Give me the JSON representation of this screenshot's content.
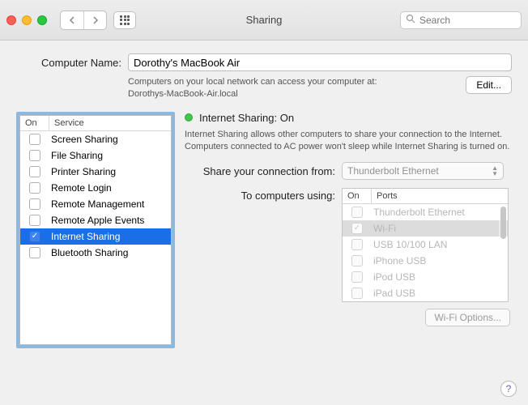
{
  "window": {
    "title": "Sharing"
  },
  "toolbar": {
    "search_placeholder": "Search"
  },
  "computerName": {
    "label": "Computer Name:",
    "value": "Dorothy's MacBook Air",
    "hint_line1": "Computers on your local network can access your computer at:",
    "hint_line2": "Dorothys-MacBook-Air.local",
    "edit_label": "Edit..."
  },
  "serviceHeader": {
    "on": "On",
    "service": "Service"
  },
  "services": [
    {
      "label": "Screen Sharing",
      "checked": false
    },
    {
      "label": "File Sharing",
      "checked": false
    },
    {
      "label": "Printer Sharing",
      "checked": false
    },
    {
      "label": "Remote Login",
      "checked": false
    },
    {
      "label": "Remote Management",
      "checked": false
    },
    {
      "label": "Remote Apple Events",
      "checked": false
    },
    {
      "label": "Internet Sharing",
      "checked": true,
      "selected": true
    },
    {
      "label": "Bluetooth Sharing",
      "checked": false
    }
  ],
  "status": {
    "title": "Internet Sharing: On",
    "color": "#42c54f"
  },
  "description": "Internet Sharing allows other computers to share your connection to the Internet. Computers connected to AC power won't sleep while Internet Sharing is turned on.",
  "shareFrom": {
    "label": "Share your connection from:",
    "value": "Thunderbolt Ethernet"
  },
  "toComputers": {
    "label": "To computers using:"
  },
  "portsHeader": {
    "on": "On",
    "ports": "Ports"
  },
  "ports": [
    {
      "label": "Thunderbolt Ethernet",
      "checked": false
    },
    {
      "label": "Wi-Fi",
      "checked": true,
      "selected": true
    },
    {
      "label": "USB 10/100 LAN",
      "checked": false
    },
    {
      "label": "iPhone USB",
      "checked": false
    },
    {
      "label": "iPod USB",
      "checked": false
    },
    {
      "label": "iPad USB",
      "checked": false
    }
  ],
  "wifiOptions": "Wi-Fi Options...",
  "help": "?"
}
